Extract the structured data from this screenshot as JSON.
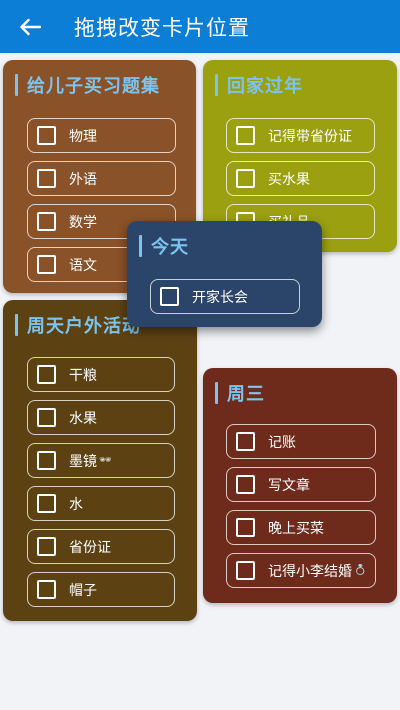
{
  "appbar": {
    "title": "拖拽改变卡片位置",
    "back_icon": "arrow-left-icon",
    "background": "#0c7ed6"
  },
  "colors": {
    "accent_text": "#7cc4ef",
    "card_brown": "#8a5228",
    "card_olive": "#9aa00f",
    "card_navy": "#2a4569",
    "card_darkbrown": "#5c4213",
    "card_maroon": "#6e2a1b"
  },
  "cards": [
    {
      "title": "给儿子买习题集",
      "items": [
        "物理",
        "外语",
        "数学",
        "语文"
      ]
    },
    {
      "title": "回家过年",
      "items": [
        "记得带省份证",
        "买水果",
        "买礼品"
      ]
    },
    {
      "title": "今天",
      "items": [
        "开家长会"
      ]
    },
    {
      "title": "周天户外活动",
      "items": [
        "干粮",
        "水果",
        "墨镜",
        "水",
        "省份证",
        "帽子"
      ]
    },
    {
      "title": "周三",
      "items": [
        "记账",
        "写文章",
        "晚上买菜",
        "记得小李结婚"
      ]
    }
  ],
  "decorations": {
    "sunglasses_emoji": "🕶",
    "ring_emoji": "💍"
  }
}
